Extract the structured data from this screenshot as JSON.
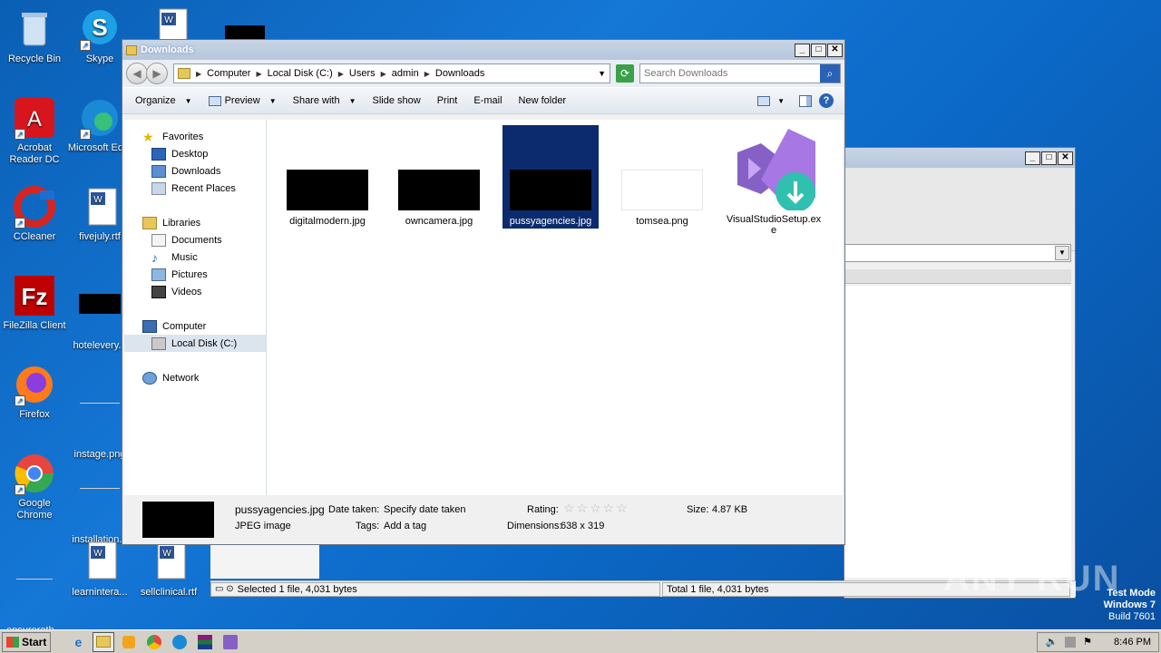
{
  "desktop": {
    "icons": [
      {
        "label": "Recycle Bin"
      },
      {
        "label": "Skype"
      },
      {
        "label": "Acrobat Reader DC"
      },
      {
        "label": "Microsoft Ed..."
      },
      {
        "label": "CCleaner"
      },
      {
        "label": "fivejuly.rtf"
      },
      {
        "label": "FileZilla Client"
      },
      {
        "label": "hotelevery..."
      },
      {
        "label": "Firefox"
      },
      {
        "label": "instage.png"
      },
      {
        "label": "Google Chrome"
      },
      {
        "label": "installation..."
      },
      {
        "label": "ensurerath..."
      },
      {
        "label": "learnintera..."
      },
      {
        "label": "sellclinical.rtf"
      }
    ]
  },
  "explorer": {
    "title": "Downloads",
    "breadcrumb": [
      "Computer",
      "Local Disk (C:)",
      "Users",
      "admin",
      "Downloads"
    ],
    "search_placeholder": "Search Downloads",
    "toolbar": {
      "organize": "Organize",
      "preview": "Preview",
      "share_with": "Share with",
      "slide_show": "Slide show",
      "print": "Print",
      "email": "E-mail",
      "new_folder": "New folder"
    },
    "nav": {
      "favorites": "Favorites",
      "desktop": "Desktop",
      "downloads": "Downloads",
      "recent": "Recent Places",
      "libraries": "Libraries",
      "documents": "Documents",
      "music": "Music",
      "pictures": "Pictures",
      "videos": "Videos",
      "computer": "Computer",
      "local_disk": "Local Disk (C:)",
      "network": "Network"
    },
    "files": [
      {
        "name": "digitalmodern.jpg"
      },
      {
        "name": "owncamera.jpg"
      },
      {
        "name": "pussyagencies.jpg"
      },
      {
        "name": "tomsea.png"
      },
      {
        "name": "VisualStudioSetup.exe"
      }
    ],
    "details": {
      "filename": "pussyagencies.jpg",
      "type": "JPEG image",
      "date_label": "Date taken:",
      "date_value": "Specify date taken",
      "tags_label": "Tags:",
      "tags_value": "Add a tag",
      "rating_label": "Rating:",
      "dimensions_label": "Dimensions:",
      "dimensions_value": "638 x 319",
      "size_label": "Size:",
      "size_value": "4.87 KB"
    }
  },
  "statusbar": {
    "selected": "Selected 1 file, 4,031 bytes",
    "total": "Total 1 file, 4,031 bytes"
  },
  "taskbar": {
    "start": "Start",
    "clock": "8:46 PM"
  },
  "overlay": {
    "watermark": "ANY RUN",
    "test_mode": "Test Mode",
    "os": "Windows 7",
    "build": "Build 7601"
  }
}
